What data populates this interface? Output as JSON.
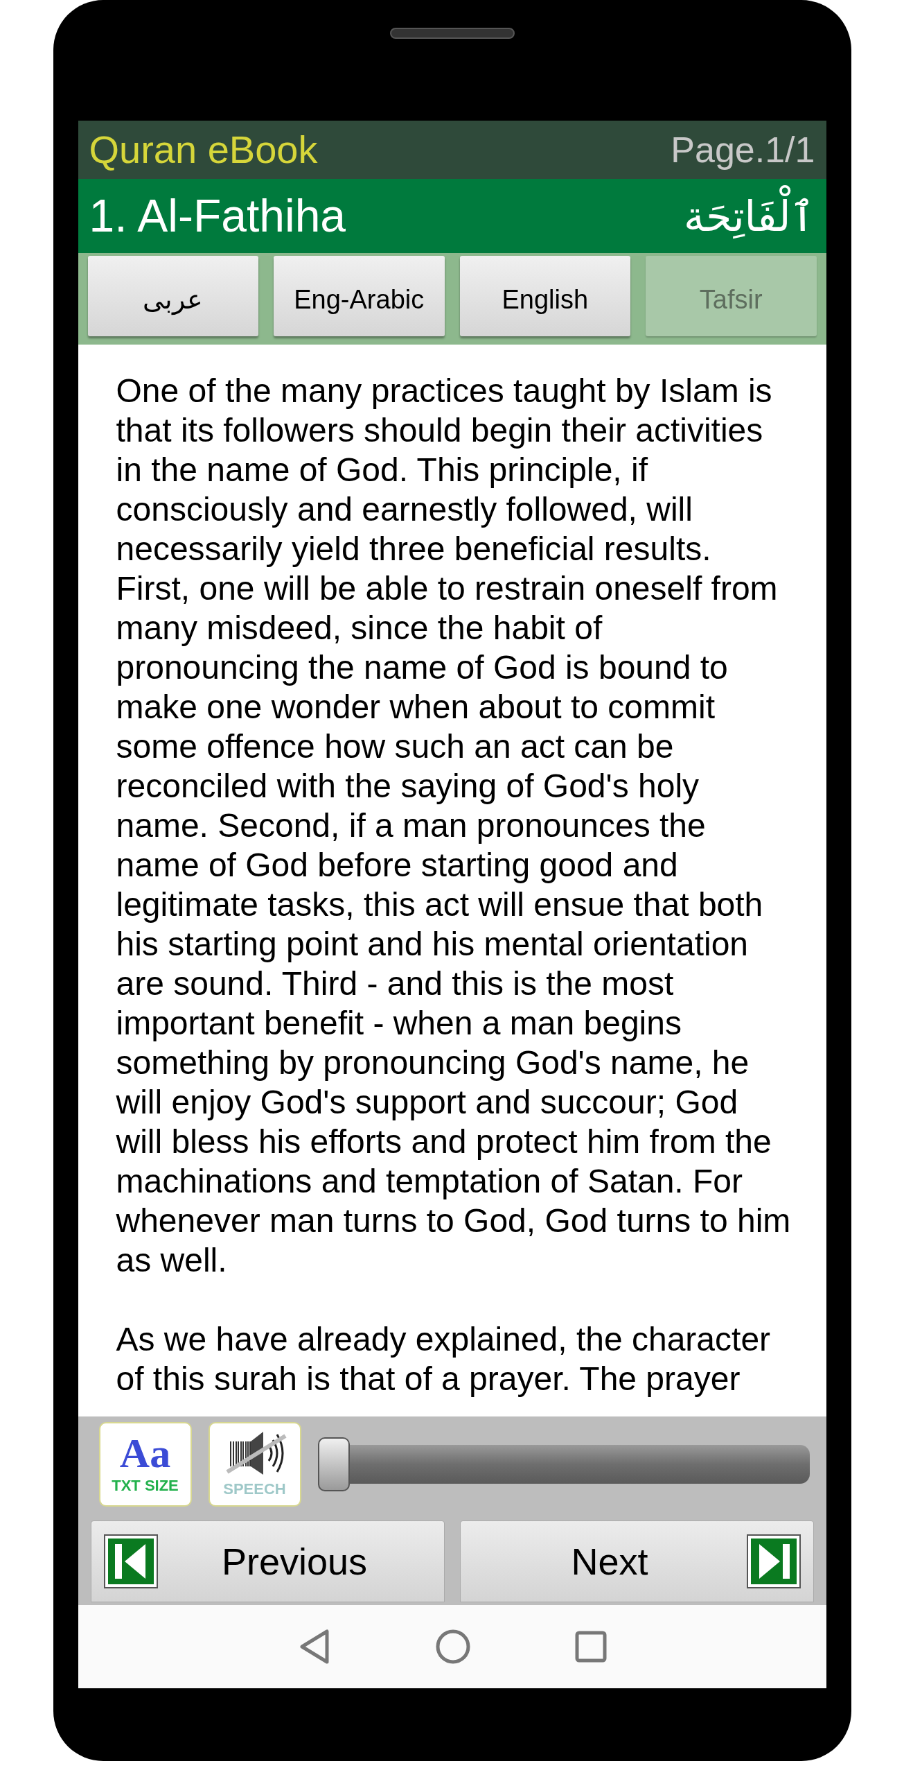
{
  "app_bar": {
    "title": "Quran eBook",
    "page": "Page.1/1"
  },
  "surah_bar": {
    "name": "1. Al-Fathiha",
    "arabic_name": "ٱلْفَاتِحَة"
  },
  "tabs": [
    {
      "label": "عربى",
      "selected": false
    },
    {
      "label": "Eng-Arabic",
      "selected": false
    },
    {
      "label": "English",
      "selected": false
    },
    {
      "label": "Tafsir",
      "selected": true
    }
  ],
  "content": {
    "paragraphs": [
      "One of the many practices taught by Islam is that its followers should begin their activities in the name of God. This principle, if consciously and earnestly followed, will necessarily yield three beneficial results. First, one will be able to restrain oneself from many misdeed, since the habit of pronouncing the name of God is bound to make one wonder when about to commit some offence how such an act can be reconciled with the saying of God's holy name. Second, if a man pronounces the name of God before starting good and legitimate tasks, this act will ensue that both his starting point and his mental orientation are sound. Third - and this is the most important benefit - when a man begins something by pronouncing God's name, he will enjoy God's support and succour; God will bless his efforts and protect him from the machinations and temptation of Satan. For whenever man turns to God, God turns to him as well.",
      "As we have already explained, the character of this surah is that of a prayer. The prayer"
    ]
  },
  "controls": {
    "text_size": {
      "glyph": "Aa",
      "label": "TXT SIZE"
    },
    "speech": {
      "label": "SPEECH"
    },
    "slider": {
      "level": 0
    }
  },
  "nav_buttons": [
    {
      "kind": "previous",
      "label": "Previous"
    },
    {
      "kind": "next",
      "label": "Next"
    }
  ]
}
